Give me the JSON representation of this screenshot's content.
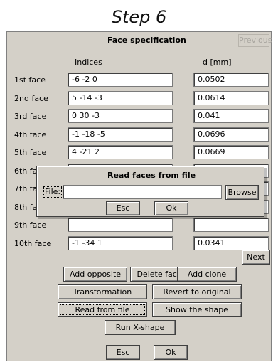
{
  "step_title": "Step 6",
  "window": {
    "title": "Face specification",
    "previous_label": "Previous",
    "next_label": "Next",
    "col_indices": "Indices",
    "col_d": "d [mm]"
  },
  "faces": [
    {
      "label": "1st face",
      "indices": "-6 -2 0",
      "d": "0.0502"
    },
    {
      "label": "2nd face",
      "indices": "5 -14 -3",
      "d": "0.0614"
    },
    {
      "label": "3rd face",
      "indices": "0 30 -3",
      "d": "0.041"
    },
    {
      "label": "4th face",
      "indices": "-1 -18 -5",
      "d": "0.0696"
    },
    {
      "label": "5th face",
      "indices": "4 -21 2",
      "d": "0.0669"
    },
    {
      "label": "6th face",
      "indices": "",
      "d": ""
    },
    {
      "label": "7th face",
      "indices": "",
      "d": ""
    },
    {
      "label": "8th face",
      "indices": "",
      "d": ""
    },
    {
      "label": "9th face",
      "indices": "",
      "d": ""
    },
    {
      "label": "10th face",
      "indices": "-1 -34 1",
      "d": "0.0341"
    }
  ],
  "buttons": {
    "add_opposite": "Add opposite",
    "delete_face": "Delete face",
    "add_clone": "Add clone",
    "transformation": "Transformation",
    "revert": "Revert to original",
    "read_from_file": "Read from file",
    "show_shape": "Show the shape",
    "run_xshape": "Run X-shape",
    "esc": "Esc",
    "ok": "Ok"
  },
  "dialog": {
    "title": "Read faces from file",
    "file_label": "File:",
    "file_value": "",
    "browse_label": "Browse",
    "esc": "Esc",
    "ok": "Ok"
  }
}
